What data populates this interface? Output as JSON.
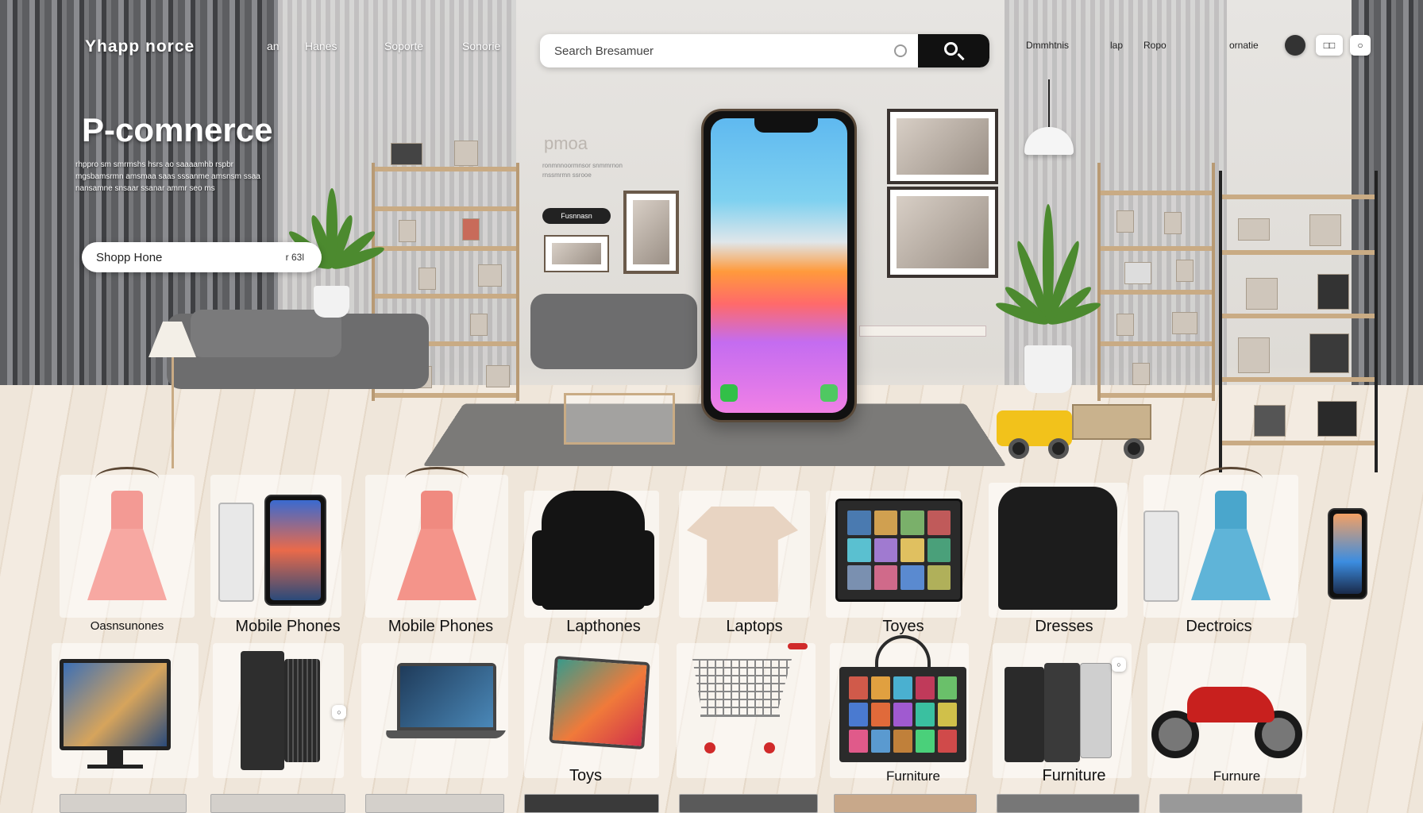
{
  "nav": {
    "logo": "Yhapp norce",
    "links": [
      "an",
      "Hanes",
      "Soporte",
      "Sonorie"
    ],
    "right_links": [
      "Dmmhtnis",
      "lap",
      "Ropo",
      "ornatie"
    ]
  },
  "search": {
    "placeholder": "Search Bresamuer"
  },
  "icons": {
    "search": "search-icon",
    "account": "user-icon",
    "cart": "cart-icon",
    "settings": "gear-icon"
  },
  "hero": {
    "title": "P-comnerce",
    "description": "rhppro sm smrmshs hsrs ao saaaamhb rspbr mgsbamsrmn amsmaa saas sssanme amsnsm ssaa nansamne snsaar ssanar ammr seo ms",
    "cta_label": "Shopp Hone",
    "cta_badge": "r 63l"
  },
  "promo": {
    "label": "pmoa",
    "lines": "ronmnnoormnsor snmmrnon rnssmrmn ssrooe",
    "button": "Fusnnasn"
  },
  "categories_row1": [
    {
      "label": "Oasnsunones"
    },
    {
      "label": "Mobile Phones"
    },
    {
      "label": "Mobile Phones"
    },
    {
      "label": "Lapthones"
    },
    {
      "label": "Laptops"
    },
    {
      "label": "Toyes"
    },
    {
      "label": "Dresses"
    },
    {
      "label": "Dectroics"
    }
  ],
  "categories_row2": [
    {
      "label": "Toys"
    },
    {
      "label": "Furniture"
    },
    {
      "label": "Furniture"
    },
    {
      "label": "Furnure"
    }
  ],
  "colors": {
    "accent": "#111111",
    "dress_pink": "#f39a94",
    "dress_blue": "#5fb4d8",
    "moto_red": "#c8201e",
    "truck_yellow": "#f2c21b"
  }
}
